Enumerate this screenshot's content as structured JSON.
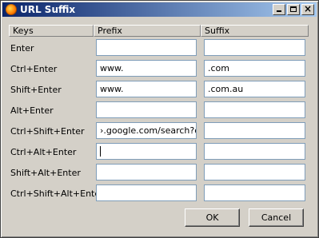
{
  "window": {
    "title": "URL Suffix"
  },
  "columns": {
    "keys": "Keys",
    "prefix": "Prefix",
    "suffix": "Suffix"
  },
  "rows": [
    {
      "key": "Enter",
      "prefix": "",
      "suffix": ""
    },
    {
      "key": "Ctrl+Enter",
      "prefix": "www.",
      "suffix": ".com"
    },
    {
      "key": "Shift+Enter",
      "prefix": "www.",
      "suffix": ".com.au"
    },
    {
      "key": "Alt+Enter",
      "prefix": "",
      "suffix": ""
    },
    {
      "key": "Ctrl+Shift+Enter",
      "prefix": "›.google.com/search?q=",
      "suffix": ""
    },
    {
      "key": "Ctrl+Alt+Enter",
      "prefix": "",
      "suffix": ""
    },
    {
      "key": "Shift+Alt+Enter",
      "prefix": "",
      "suffix": ""
    },
    {
      "key": "Ctrl+Shift+Alt+Enter",
      "prefix": "",
      "suffix": ""
    }
  ],
  "buttons": {
    "ok": "OK",
    "cancel": "Cancel"
  },
  "icons": {
    "app": "firefox-icon",
    "minimize": "minimize-icon",
    "maximize": "maximize-icon",
    "close": "close-icon"
  },
  "colors": {
    "title_bar_start": "#0a246a",
    "title_bar_end": "#a6caf0",
    "dialog_bg": "#d4d0c8"
  },
  "focus": {
    "row_index": 5,
    "column": "prefix"
  }
}
